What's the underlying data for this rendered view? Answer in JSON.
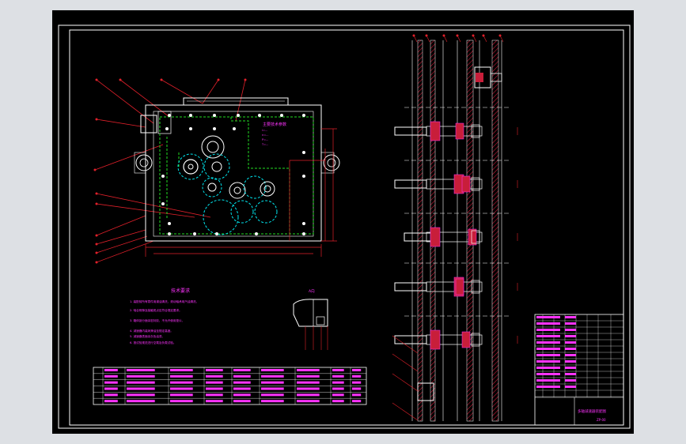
{
  "colors": {
    "canvas_bg": "#000000",
    "app_bg": "#dde0e4",
    "frame": "#ffffff",
    "dimension": "#e0202a",
    "text_magenta": "#ff33ff",
    "green_hidden": "#22dd22",
    "cyan": "#00e5ee",
    "hatch": "#ff2a6a",
    "red_hatch": "#c81e3a"
  },
  "drawing": {
    "gearbox_view": {
      "tech_spec_title": "主要技术参数",
      "spec_lines": [
        "i=...",
        "n=...",
        "P=...",
        "T=..."
      ]
    },
    "tech_requirements": {
      "title": "技术要求",
      "items": [
        "1. 装配前所有零件用煤油清洗，滚动轴承用汽油清洗。",
        "2. 啮合侧隙及接触斑点应符合规定要求。",
        "3. 箱体剖分面涂密封胶，不允许使用垫片。",
        "4. 减速器内装润滑油至规定高度。",
        "5. 减速器表面涂灰色油漆。",
        "6. 按试验规范进行空载及负载试验。"
      ]
    },
    "detail_label": "A向",
    "parts_table_rows": 6,
    "side_section": {
      "right_notes": [
        "Ⅰ",
        "Ⅱ",
        "Ⅲ",
        "Ⅳ",
        "Ⅴ"
      ]
    },
    "title_block": {
      "drawing_name": "多轴减速器装配图",
      "drawing_no": "ZP-00"
    }
  }
}
